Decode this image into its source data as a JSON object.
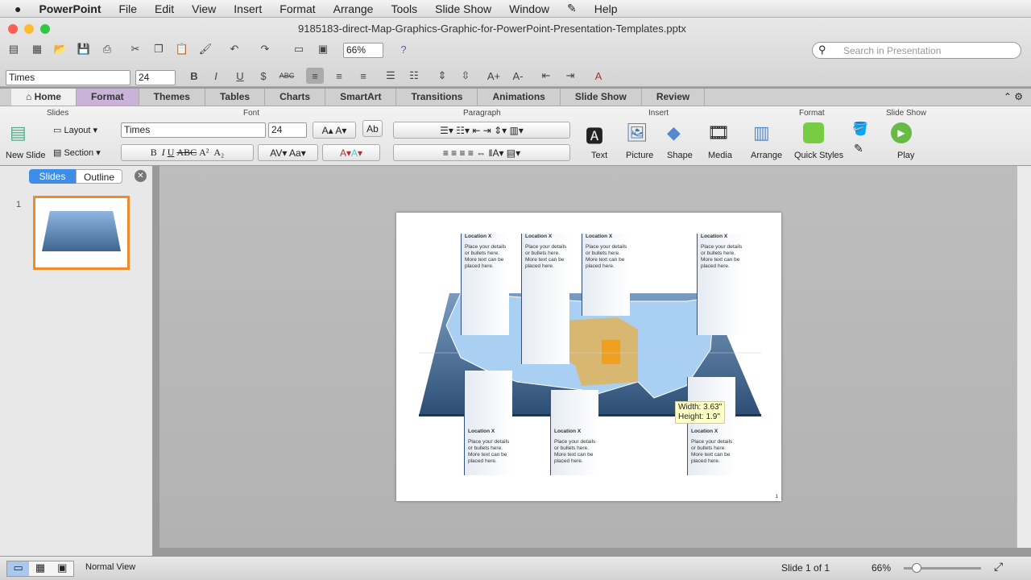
{
  "menubar": {
    "apple": "",
    "app": "PowerPoint",
    "items": [
      "File",
      "Edit",
      "View",
      "Insert",
      "Format",
      "Arrange",
      "Tools",
      "Slide Show",
      "Window",
      "✎",
      "Help"
    ]
  },
  "window": {
    "title": "9185183-direct-Map-Graphics-Graphic-for-PowerPoint-Presentation-Templates.pptx",
    "zoom": "66%",
    "search_placeholder": "Search in Presentation"
  },
  "formatbar": {
    "font": "Times",
    "size": "24"
  },
  "tabs": [
    "Home",
    "Format",
    "Themes",
    "Tables",
    "Charts",
    "SmartArt",
    "Transitions",
    "Animations",
    "Slide Show",
    "Review"
  ],
  "ribbon": {
    "groups": {
      "slides": "Slides",
      "font": "Font",
      "paragraph": "Paragraph",
      "insert": "Insert",
      "format": "Format",
      "slideshow": "Slide Show"
    },
    "new_slide": "New Slide",
    "layout": "Layout",
    "section": "Section",
    "font": "Times",
    "size": "24",
    "insert": [
      "Text",
      "Picture",
      "Shape",
      "Media"
    ],
    "arrange": "Arrange",
    "quick_styles": "Quick Styles",
    "play": "Play"
  },
  "panel": {
    "tabs": [
      "Slides",
      "Outline"
    ],
    "slide_number": "1"
  },
  "slide": {
    "callout_title": "Location X",
    "callout_body": "Place your details or bullets here. More text can be placed here.",
    "page_number": "1",
    "tooltip": {
      "width": "Width: 3.63\"",
      "height": "Height: 1.9\""
    }
  },
  "status": {
    "view": "Normal View",
    "slide": "Slide 1 of 1",
    "zoom": "66%"
  }
}
